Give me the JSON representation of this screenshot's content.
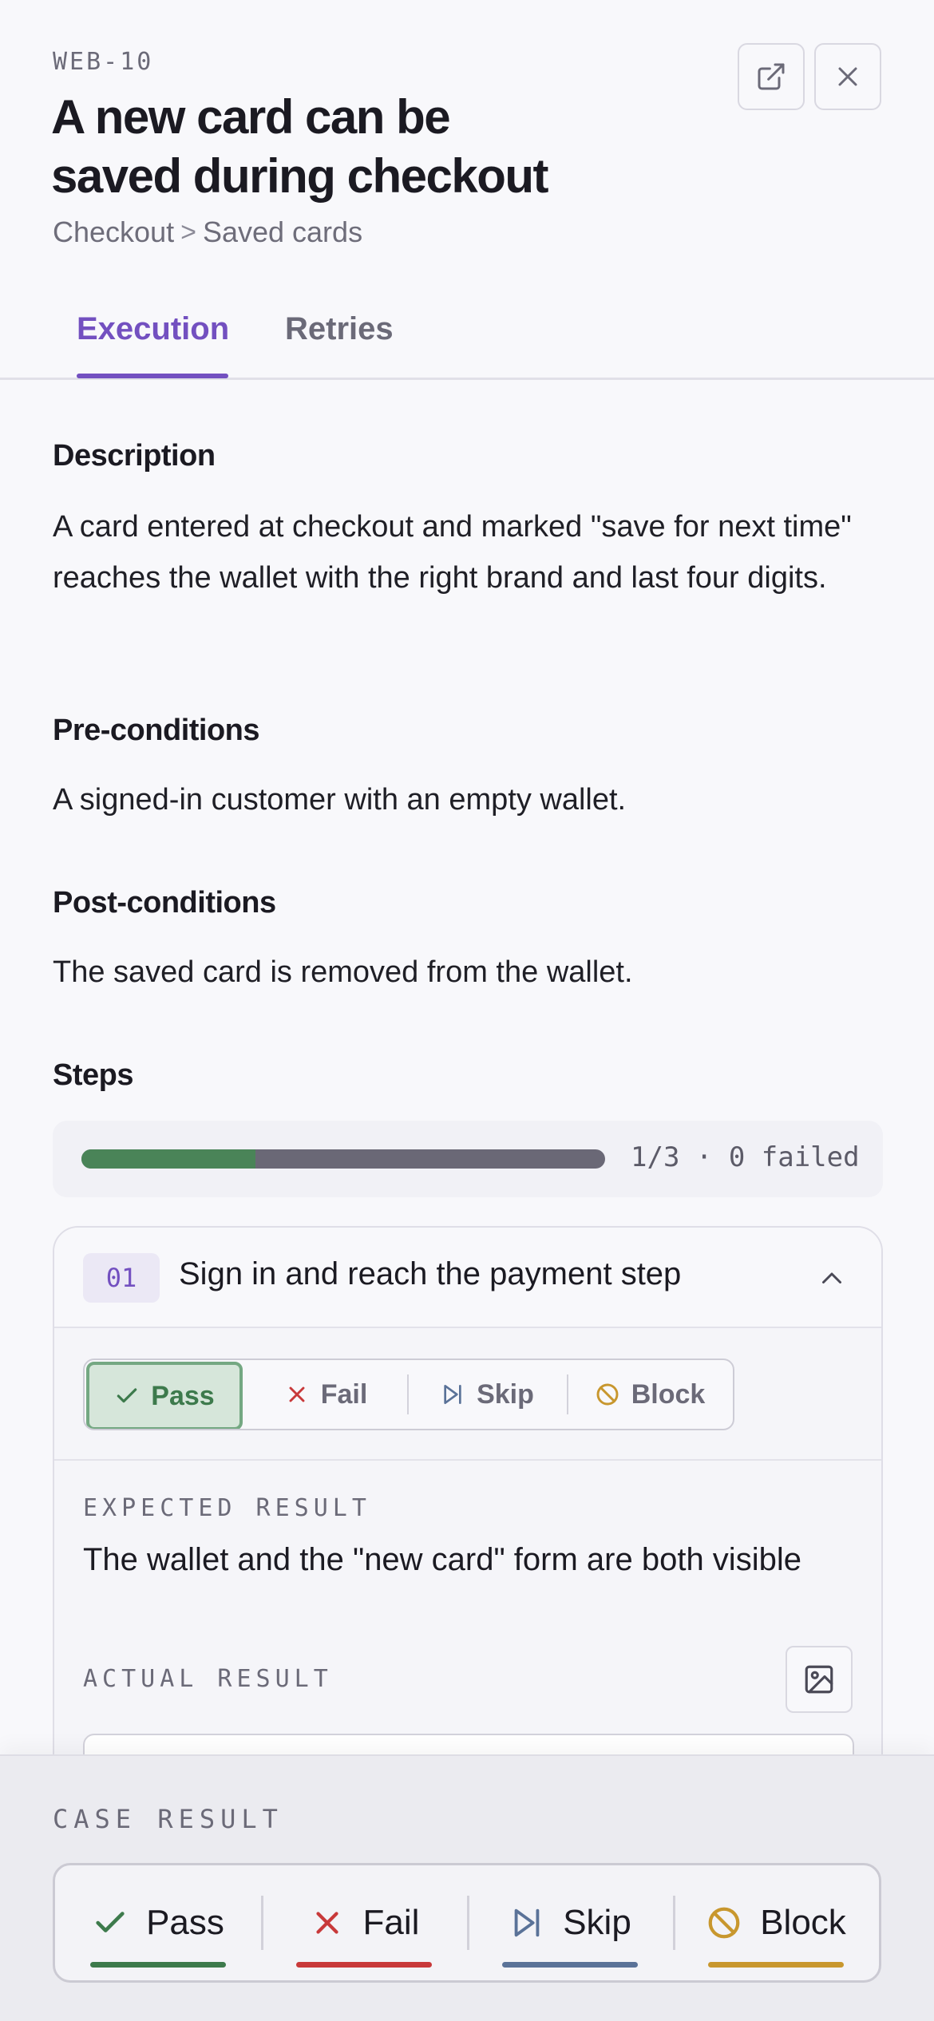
{
  "header": {
    "case_id": "WEB-10",
    "title": "A new card can be saved during checkout",
    "breadcrumb": {
      "parent": "Checkout",
      "separator": ">",
      "current": "Saved cards"
    }
  },
  "tabs": [
    {
      "label": "Execution",
      "active": true
    },
    {
      "label": "Retries",
      "active": false
    }
  ],
  "description": {
    "heading": "Description",
    "text": "A card entered at checkout and marked \"save for next time\" reaches the wallet with the right brand and last four digits."
  },
  "preconditions": {
    "heading": "Pre-conditions",
    "text": "A signed-in customer with an empty wallet."
  },
  "postconditions": {
    "heading": "Post-conditions",
    "text": "The saved card is removed from the wallet."
  },
  "steps": {
    "heading": "Steps",
    "progress_fraction": 0.333,
    "progress_text": "1/3 · 0 failed",
    "step": {
      "number": "01",
      "title": "Sign in and reach the payment step",
      "selected_status": "Pass",
      "status_options": [
        "Pass",
        "Fail",
        "Skip",
        "Block"
      ],
      "expected_label": "EXPECTED RESULT",
      "expected_text": "The wallet and the \"new card\" form are both visible",
      "actual_label": "ACTUAL RESULT"
    }
  },
  "case_result": {
    "label": "CASE RESULT",
    "options": [
      "Pass",
      "Fail",
      "Skip",
      "Block"
    ]
  },
  "colors": {
    "accent": "#7350c0",
    "pass": "#3d7a4c",
    "fail": "#c8393a",
    "skip": "#5a7298",
    "block": "#c8972e"
  }
}
